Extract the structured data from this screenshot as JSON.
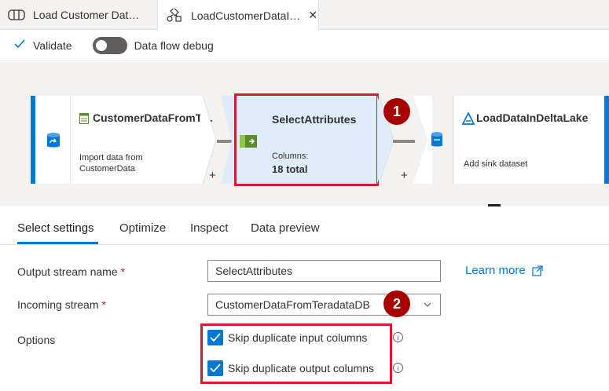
{
  "tabs": [
    {
      "label": "Load Customer Dat…",
      "icon": "pipeline-icon"
    },
    {
      "label": "LoadCustomerDataI…",
      "icon": "dataflow-icon",
      "close": "✕"
    }
  ],
  "toolbar": {
    "validate_label": "Validate",
    "debug_label": "Data flow debug",
    "debug_on": false
  },
  "canvas": {
    "source": {
      "title": "CustomerDataFromT…",
      "subtitle": "Import data from CustomerData",
      "add": "+"
    },
    "select": {
      "title": "SelectAttributes",
      "columns_label": "Columns:",
      "columns_value": "18 total",
      "add": "+"
    },
    "sink": {
      "title": "LoadDataInDeltaLake",
      "subtitle": "Add sink dataset"
    },
    "callout_1": "1"
  },
  "settings_tabs": [
    "Select settings",
    "Optimize",
    "Inspect",
    "Data preview"
  ],
  "form": {
    "output_stream_label": "Output stream name",
    "output_stream_value": "SelectAttributes",
    "incoming_stream_label": "Incoming stream",
    "incoming_stream_value": "CustomerDataFromTeradataDB",
    "required_mark": "*",
    "options_label": "Options",
    "learn_more": "Learn more",
    "option_1": "Skip duplicate input columns",
    "option_2": "Skip duplicate output columns",
    "option_1_checked": true,
    "option_2_checked": true,
    "callout_2": "2"
  },
  "colors": {
    "accent": "#0078d4",
    "callout": "#a80000",
    "highlight": "#d41c30"
  }
}
